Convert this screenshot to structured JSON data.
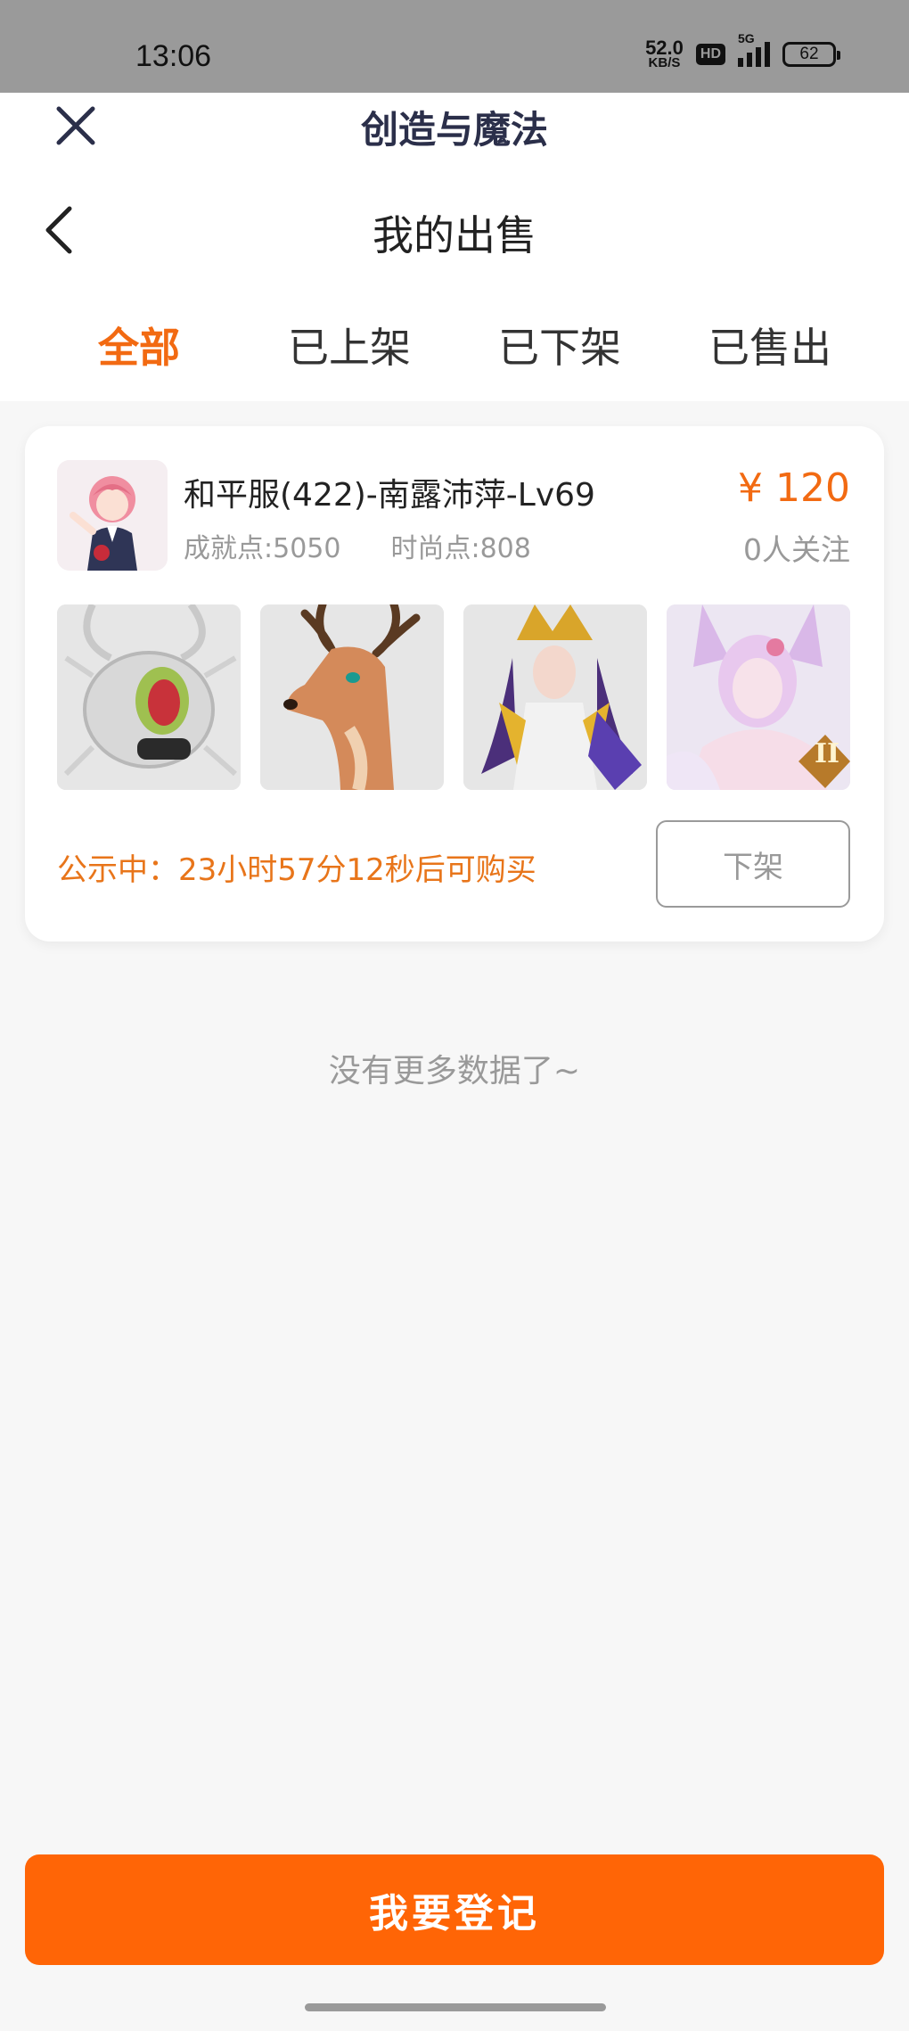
{
  "status_bar": {
    "time": "13:06",
    "net_speed_value": "52.0",
    "net_speed_unit": "KB/S",
    "hd_badge": "HD",
    "network": "5G",
    "battery": "62"
  },
  "header": {
    "app_title": "创造与魔法",
    "page_title": "我的出售",
    "close_icon": "close-icon",
    "back_icon": "chevron-left-icon"
  },
  "tabs": [
    {
      "label": "全部",
      "active": true
    },
    {
      "label": "已上架",
      "active": false
    },
    {
      "label": "已下架",
      "active": false
    },
    {
      "label": "已售出",
      "active": false
    }
  ],
  "listing": {
    "title": "和平服(422)-南露沛萍-Lv69",
    "achievement": "成就点:5050",
    "fashion": "时尚点:808",
    "price": "¥ 120",
    "followers": "0人关注",
    "thumbnails": [
      "silver-mecha-mount",
      "antlered-deer-mount",
      "golden-armored-queen",
      "fox-spirit-girl"
    ],
    "thumb_badge": "II",
    "notice": "公示中：23小时57分12秒后可购买",
    "delist_label": "下架"
  },
  "footer": {
    "no_more": "没有更多数据了~",
    "register_label": "我要登记"
  },
  "colors": {
    "accent": "#f26a12",
    "button": "#ff6506",
    "status_bar": "#9a9a9a"
  }
}
